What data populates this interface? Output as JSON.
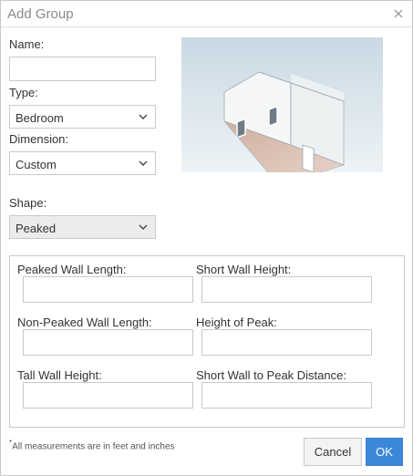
{
  "dialog": {
    "title": "Add Group"
  },
  "form": {
    "name_label": "Name:",
    "name_value": "",
    "type_label": "Type:",
    "type_value": "Bedroom",
    "dimension_label": "Dimension:",
    "dimension_value": "Custom",
    "shape_label": "Shape:",
    "shape_value": "Peaked"
  },
  "measurements": {
    "peaked_wall_length_label": "Peaked Wall Length:",
    "short_wall_height_label": "Short Wall Height:",
    "non_peaked_wall_length_label": "Non-Peaked Wall Length:",
    "height_of_peak_label": "Height of Peak:",
    "tall_wall_height_label": "Tall Wall Height:",
    "short_wall_to_peak_label": "Short Wall to Peak Distance:"
  },
  "footer": {
    "note_asterisk": "*",
    "note_text": "All measurements are in feet and inches",
    "cancel_label": "Cancel",
    "ok_label": "OK"
  },
  "icons": {
    "close": "close-icon",
    "chevron": "chevron-down-icon"
  },
  "colors": {
    "accent": "#3c87d8",
    "border": "#c9c9c9",
    "disabled_bg": "#ececec"
  }
}
